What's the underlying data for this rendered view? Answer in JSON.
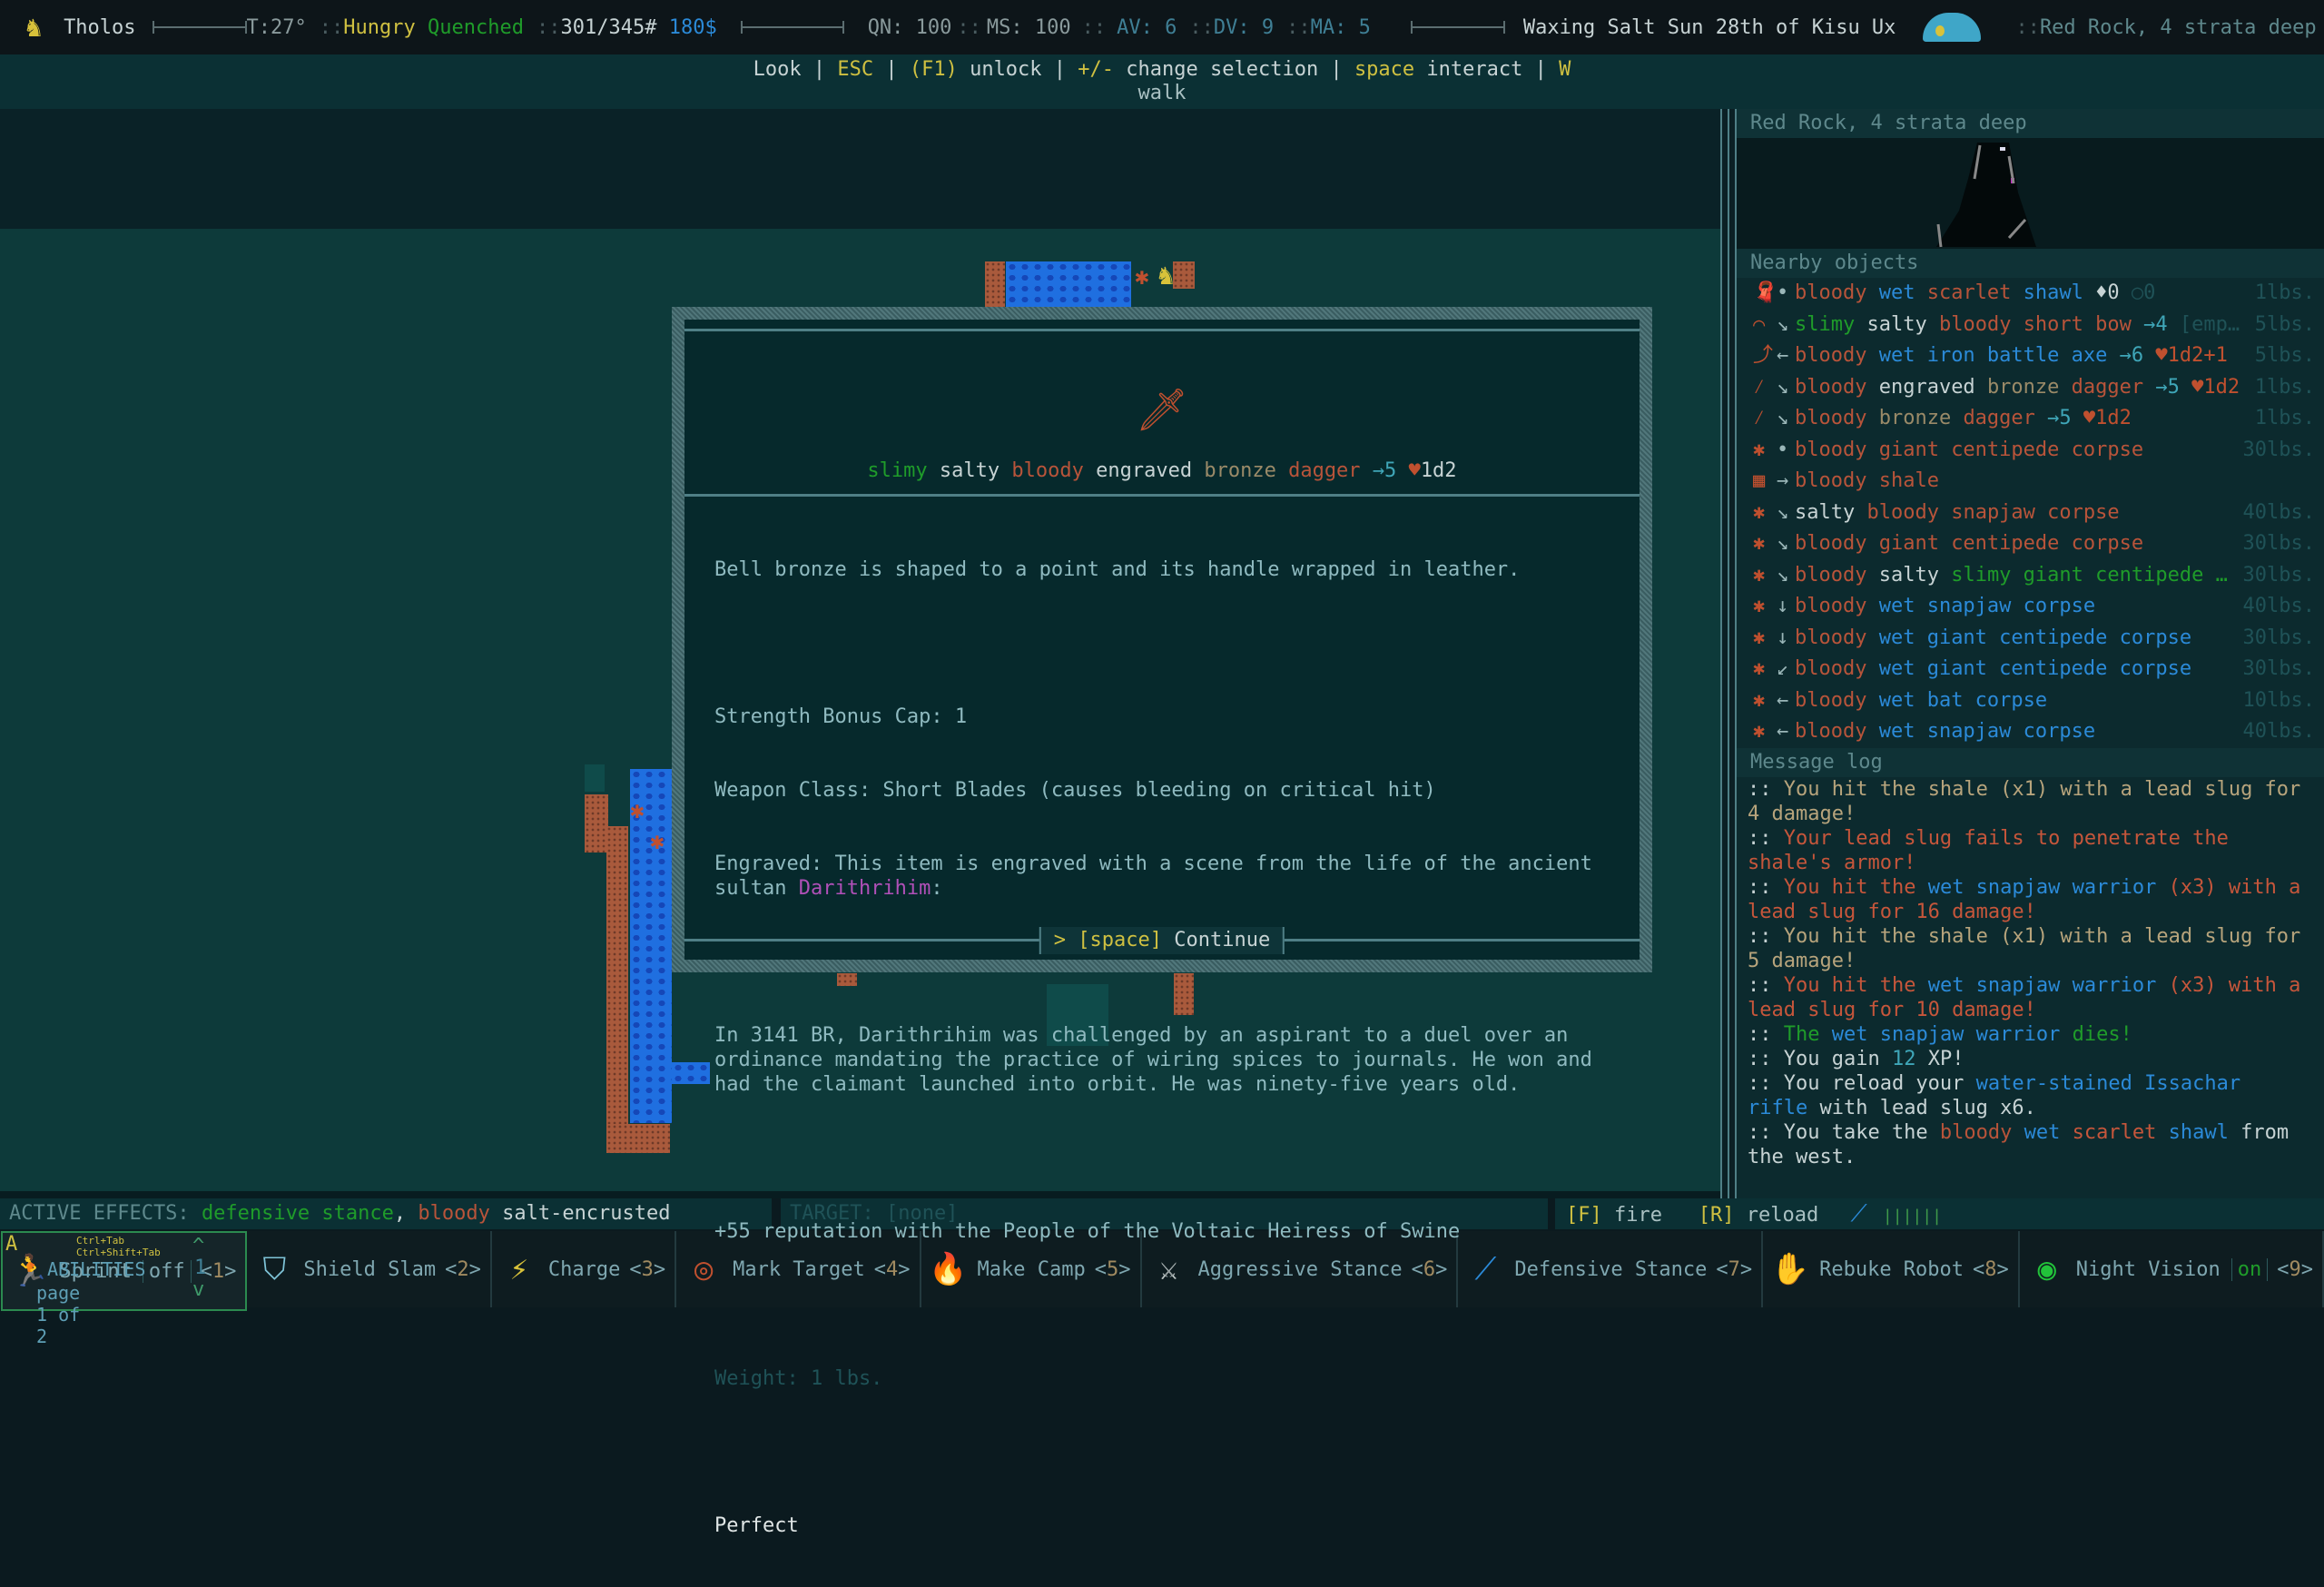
{
  "topbar": {
    "character_name": "Tholos",
    "temperature": "T:27°",
    "hunger": "Hungry",
    "thirst": "Quenched",
    "hp": "301/345#",
    "money": "180$",
    "qn": "QN: 100",
    "ms": "MS: 100",
    "av": "AV: 6",
    "dv": "DV: 9",
    "ma": "MA: 5",
    "date": "Waxing Salt Sun 28th of Kisu Ux",
    "location": "Red Rock, 4 strata deep",
    "separator": "::"
  },
  "helpbar": {
    "items": [
      {
        "text": "Look",
        "color": "white"
      },
      {
        "text": " | ",
        "color": "white"
      },
      {
        "text": "ESC",
        "color": "yellow"
      },
      {
        "text": " | ",
        "color": "white"
      },
      {
        "text": "(F1)",
        "color": "yellow"
      },
      {
        "text": " unlock | ",
        "color": "white"
      },
      {
        "text": "+/-",
        "color": "yellow"
      },
      {
        "text": " change selection | ",
        "color": "white"
      },
      {
        "text": "space",
        "color": "yellow"
      },
      {
        "text": " interact | ",
        "color": "white"
      },
      {
        "text": "W",
        "color": "yellow"
      }
    ],
    "line2": "walk"
  },
  "right_panel": {
    "location_title": "Red Rock, 4 strata deep",
    "nearby_title": "Nearby objects",
    "nearby_objects": [
      {
        "icon": "shawl-icon",
        "glyph": "🧣",
        "dir": "•",
        "parts": [
          [
            "bloody",
            "red"
          ],
          [
            "wet",
            "blue"
          ],
          [
            "scarlet",
            "red"
          ],
          [
            "shawl",
            "blue"
          ],
          [
            "♦0",
            "white-blue"
          ],
          [
            "○0",
            "dim"
          ]
        ],
        "weight": "1lbs."
      },
      {
        "icon": "bow-icon",
        "glyph": "⌒",
        "dir": "↘",
        "parts": [
          [
            "slimy",
            "green"
          ],
          [
            "salty",
            "white"
          ],
          [
            "bloody",
            "red"
          ],
          [
            "short bow",
            "red"
          ],
          [
            "→4",
            "teal"
          ],
          [
            "[emp…",
            "dim"
          ]
        ],
        "weight": "5lbs."
      },
      {
        "icon": "axe-icon",
        "glyph": "⤴",
        "dir": "←",
        "parts": [
          [
            "bloody",
            "red"
          ],
          [
            "wet iron battle axe",
            "blue"
          ],
          [
            "→6",
            "teal"
          ],
          [
            "♥1d2+1",
            "heart"
          ]
        ],
        "weight": "5lbs."
      },
      {
        "icon": "dagger-icon",
        "glyph": "⁄",
        "dir": "↘",
        "parts": [
          [
            "bloody",
            "red"
          ],
          [
            "engraved",
            "white"
          ],
          [
            "bronze",
            "tan"
          ],
          [
            "dagger",
            "red"
          ],
          [
            "→5",
            "teal"
          ],
          [
            "♥1d2",
            "heart"
          ]
        ],
        "weight": "1lbs."
      },
      {
        "icon": "dagger-icon",
        "glyph": "⁄",
        "dir": "↘",
        "parts": [
          [
            "bloody",
            "red"
          ],
          [
            "bronze",
            "tan"
          ],
          [
            "dagger",
            "red"
          ],
          [
            "→5",
            "teal"
          ],
          [
            "♥1d2",
            "heart"
          ]
        ],
        "weight": "1lbs."
      },
      {
        "icon": "corpse-icon",
        "glyph": "✱",
        "dir": "•",
        "parts": [
          [
            "bloody",
            "red"
          ],
          [
            "giant centipede corpse",
            "red"
          ]
        ],
        "weight": "30lbs."
      },
      {
        "icon": "shale-icon",
        "glyph": "▦",
        "dir": "→",
        "parts": [
          [
            "bloody",
            "red"
          ],
          [
            "shale",
            "red"
          ]
        ],
        "weight": ""
      },
      {
        "icon": "corpse-icon",
        "glyph": "✱",
        "dir": "↘",
        "parts": [
          [
            "salty",
            "white"
          ],
          [
            "bloody",
            "red"
          ],
          [
            "snapjaw corpse",
            "red"
          ]
        ],
        "weight": "40lbs."
      },
      {
        "icon": "corpse-icon",
        "glyph": "✱",
        "dir": "↘",
        "parts": [
          [
            "bloody",
            "red"
          ],
          [
            "giant centipede corpse",
            "red"
          ]
        ],
        "weight": "30lbs."
      },
      {
        "icon": "corpse-icon",
        "glyph": "✱",
        "dir": "↘",
        "parts": [
          [
            "bloody",
            "red"
          ],
          [
            "salty",
            "white"
          ],
          [
            "slimy giant centipede …",
            "green"
          ]
        ],
        "weight": "30lbs."
      },
      {
        "icon": "corpse-icon",
        "glyph": "✱",
        "dir": "↓",
        "parts": [
          [
            "bloody",
            "red"
          ],
          [
            "wet snapjaw corpse",
            "blue"
          ]
        ],
        "weight": "40lbs."
      },
      {
        "icon": "corpse-icon",
        "glyph": "✱",
        "dir": "↓",
        "parts": [
          [
            "bloody",
            "red"
          ],
          [
            "wet giant centipede corpse",
            "blue"
          ]
        ],
        "weight": "30lbs."
      },
      {
        "icon": "corpse-icon",
        "glyph": "✱",
        "dir": "↙",
        "parts": [
          [
            "bloody",
            "red"
          ],
          [
            "wet giant centipede corpse",
            "blue"
          ]
        ],
        "weight": "30lbs."
      },
      {
        "icon": "corpse-icon",
        "glyph": "✱",
        "dir": "←",
        "parts": [
          [
            "bloody",
            "red"
          ],
          [
            "wet bat corpse",
            "blue"
          ]
        ],
        "weight": "10lbs."
      },
      {
        "icon": "corpse-icon",
        "glyph": "✱",
        "dir": "←",
        "parts": [
          [
            "bloody",
            "red"
          ],
          [
            "wet snapjaw corpse",
            "blue"
          ]
        ],
        "weight": "40lbs."
      }
    ],
    "message_log_title": "Message log",
    "messages": [
      [
        [
          ":: ",
          "white"
        ],
        [
          "You hit the shale (x1) with a lead slug for 4 damage!",
          "msgtan"
        ]
      ],
      [
        [
          ":: ",
          "white"
        ],
        [
          "Your lead slug fails to penetrate the shale's armor!",
          "msgred"
        ]
      ],
      [
        [
          ":: ",
          "white"
        ],
        [
          "You hit the ",
          "msgred"
        ],
        [
          "wet snapjaw warrior",
          "blue"
        ],
        [
          " (x3) with a lead slug for 16 damage!",
          "msgred"
        ]
      ],
      [
        [
          ":: ",
          "white"
        ],
        [
          "You hit the shale (x1) with a lead slug for 5 damage!",
          "msgtan"
        ]
      ],
      [
        [
          ":: ",
          "white"
        ],
        [
          "You hit the ",
          "msgred"
        ],
        [
          "wet snapjaw warrior",
          "blue"
        ],
        [
          " (x3) with a lead slug for 10 damage!",
          "msgred"
        ]
      ],
      [
        [
          ":: ",
          "white"
        ],
        [
          "The ",
          "green"
        ],
        [
          "wet snapjaw warrior",
          "blue"
        ],
        [
          " dies!",
          "green"
        ]
      ],
      [
        [
          ":: You gain ",
          "white"
        ],
        [
          "12",
          "teal"
        ],
        [
          " XP!",
          "white"
        ]
      ],
      [
        [
          ":: You reload your ",
          "white"
        ],
        [
          "water-stained Issachar rifle",
          "blue"
        ],
        [
          " with lead slug x6.",
          "white"
        ]
      ],
      [
        [
          ":: You take the ",
          "white"
        ],
        [
          "bloody",
          "red"
        ],
        [
          " ",
          "white"
        ],
        [
          "wet",
          "blue"
        ],
        [
          " ",
          "white"
        ],
        [
          "scarlet",
          "msgred"
        ],
        [
          " ",
          "white"
        ],
        [
          "shawl",
          "blue"
        ],
        [
          " from the west.",
          "white"
        ]
      ]
    ]
  },
  "modal": {
    "title_parts": [
      [
        "slimy",
        "green"
      ],
      [
        " ",
        "white"
      ],
      [
        "salty",
        "white"
      ],
      [
        " ",
        "white"
      ],
      [
        "bloody",
        "red"
      ],
      [
        " ",
        "white"
      ],
      [
        "engraved",
        "white"
      ],
      [
        " ",
        "white"
      ],
      [
        "bronze",
        "tan"
      ],
      [
        " ",
        "white"
      ],
      [
        "dagger",
        "red"
      ],
      [
        " ",
        "white"
      ],
      [
        "→5",
        "teal"
      ],
      [
        " ",
        "white"
      ],
      [
        "♥",
        "heart"
      ],
      [
        "1d2",
        "white"
      ]
    ],
    "description": "Bell bronze is shaped to a point and its handle wrapped in leather.",
    "strength_bonus_cap": "Strength Bonus Cap: 1",
    "weapon_class": "Weapon Class: Short Blades (causes bleeding on critical hit)",
    "engraved_prefix": "Engraved: This item is engraved with a scene from the life of the ancient sultan ",
    "sultan_name": "Darithrihim",
    "engraved_suffix": ":",
    "story": "In 3141 BR, Darithrihim was challenged by an aspirant to a duel over an ordinance mandating the practice of wiring spices to journals. He won and had the claimant launched into orbit. He was ninety-five years old.",
    "reputation": "+55 reputation with the People of the Voltaic Heiress of Swine",
    "weight": "Weight: 1 lbs.",
    "condition": "Perfect",
    "continue_key": "[space]",
    "continue_label": "Continue",
    "continue_prefix": ">"
  },
  "effects_bar": {
    "label": "ACTIVE EFFECTS:",
    "effects": [
      [
        "defensive stance",
        "green"
      ],
      [
        ", ",
        "white"
      ],
      [
        "bloody",
        "red"
      ],
      [
        " ",
        "white"
      ],
      [
        "salt-encrusted",
        "white"
      ]
    ]
  },
  "target_bar": {
    "text": "TARGET: [none]"
  },
  "fire_bar": {
    "fire_key": "[F]",
    "fire_label": "fire",
    "reload_key": "[R]",
    "reload_label": "reload",
    "ammo": "||||||"
  },
  "abilities": {
    "hotkey_hint": "Ctrl+Tab  Ctrl+Shift+Tab",
    "marker": "A",
    "title": "ABILITIES",
    "page": "page 1 of 2",
    "page_number": "1",
    "items": [
      {
        "name": "Sprint",
        "state": "off",
        "key": "1",
        "glyph": "🏃",
        "color": "#a5c8c8",
        "selected": true
      },
      {
        "name": "Shield Slam",
        "state": "",
        "key": "2",
        "glyph": "⛉",
        "color": "#7fc4d8",
        "selected": false
      },
      {
        "name": "Charge",
        "state": "",
        "key": "3",
        "glyph": "⚡",
        "color": "#d8c23a",
        "selected": false
      },
      {
        "name": "Mark Target",
        "state": "",
        "key": "4",
        "glyph": "◎",
        "color": "#c0502f",
        "selected": false
      },
      {
        "name": "Make Camp",
        "state": "",
        "key": "5",
        "glyph": "🔥",
        "color": "#c8763a",
        "selected": false
      },
      {
        "name": "Aggressive Stance",
        "state": "",
        "key": "6",
        "glyph": "⚔",
        "color": "#c0c8c8",
        "selected": false
      },
      {
        "name": "Defensive Stance",
        "state": "",
        "key": "7",
        "glyph": "⟋",
        "color": "#2b8ad8",
        "selected": false
      },
      {
        "name": "Rebuke Robot",
        "state": "",
        "key": "8",
        "glyph": "✋",
        "color": "#8fd0e0",
        "selected": false
      },
      {
        "name": "Night Vision",
        "state": "on",
        "key": "9",
        "glyph": "◉",
        "color": "#22c23a",
        "selected": false
      }
    ]
  }
}
